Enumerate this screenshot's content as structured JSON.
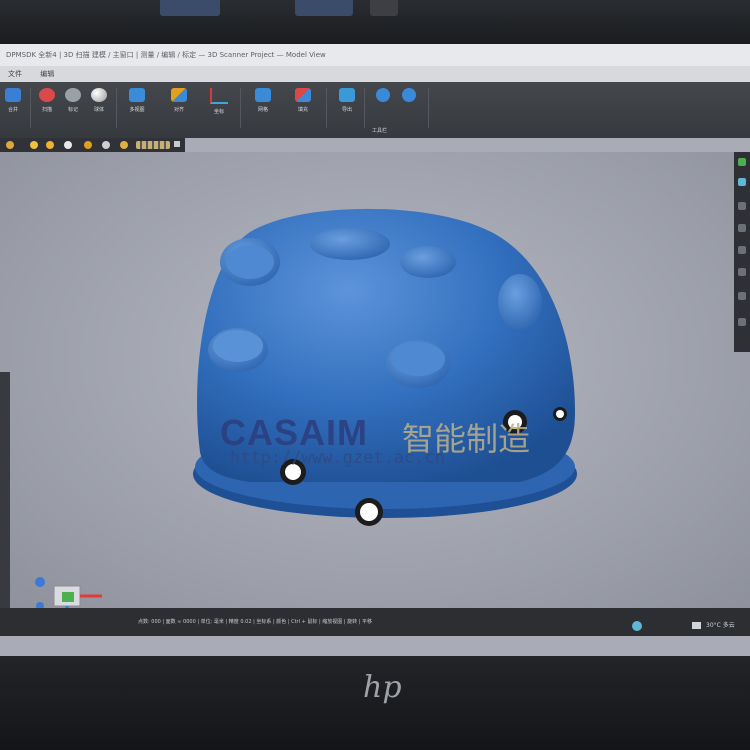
{
  "window": {
    "title": "DPMSDK 全新4 | 3D 扫描 建模 / 主窗口 | 测量 / 编辑 / 标定 — 3D Scanner Project — Model View"
  },
  "menu": {
    "items": [
      "文件",
      "编辑"
    ]
  },
  "ribbon": {
    "group_caption": "工具栏",
    "buttons": [
      {
        "label": "合并",
        "icon": "merge-icon",
        "color": "#3b7fd4"
      },
      {
        "label": "扫描",
        "icon": "scan-icon",
        "color": "#d94a4a"
      },
      {
        "label": "标记",
        "icon": "marker-icon",
        "color": "#9aa0a8"
      },
      {
        "label": "球体",
        "icon": "sphere-icon",
        "color": "#c8c8c8"
      },
      {
        "label": "多视图",
        "icon": "multiview-icon",
        "color": "#3b8cd8"
      },
      {
        "label": "对齐",
        "icon": "align-icon",
        "color": "#e0a020"
      },
      {
        "label": "坐标",
        "icon": "axes-icon",
        "color": "#d83a3a"
      },
      {
        "label": "网格",
        "icon": "mesh-icon",
        "color": "#3a8ad8"
      },
      {
        "label": "填充",
        "icon": "fill-icon",
        "color": "#d84a4a"
      },
      {
        "label": "导出",
        "icon": "export-icon",
        "color": "#3a9ad8"
      },
      {
        "label": "工具",
        "icon": "tool-icon",
        "color": "#3a8ad8"
      }
    ]
  },
  "status": {
    "text": "点数: 000 | 面数 ≈ 0000 | 单位: 毫米 | 精度 0.02 | 坐标系 | 颜色 | Ctrl + 鼠标 | 缩放视图 | 旋转 | 平移",
    "tray": "30°C 多云"
  },
  "watermark": {
    "brand": "CASAIM",
    "cn": "智能制造",
    "url": "http://www.gzet.ac.cn"
  },
  "monitor": {
    "brand": "hp"
  },
  "colors": {
    "model": "#2f6fc2",
    "viewport": "#a9acb6",
    "ribbon": "#3d4045"
  }
}
